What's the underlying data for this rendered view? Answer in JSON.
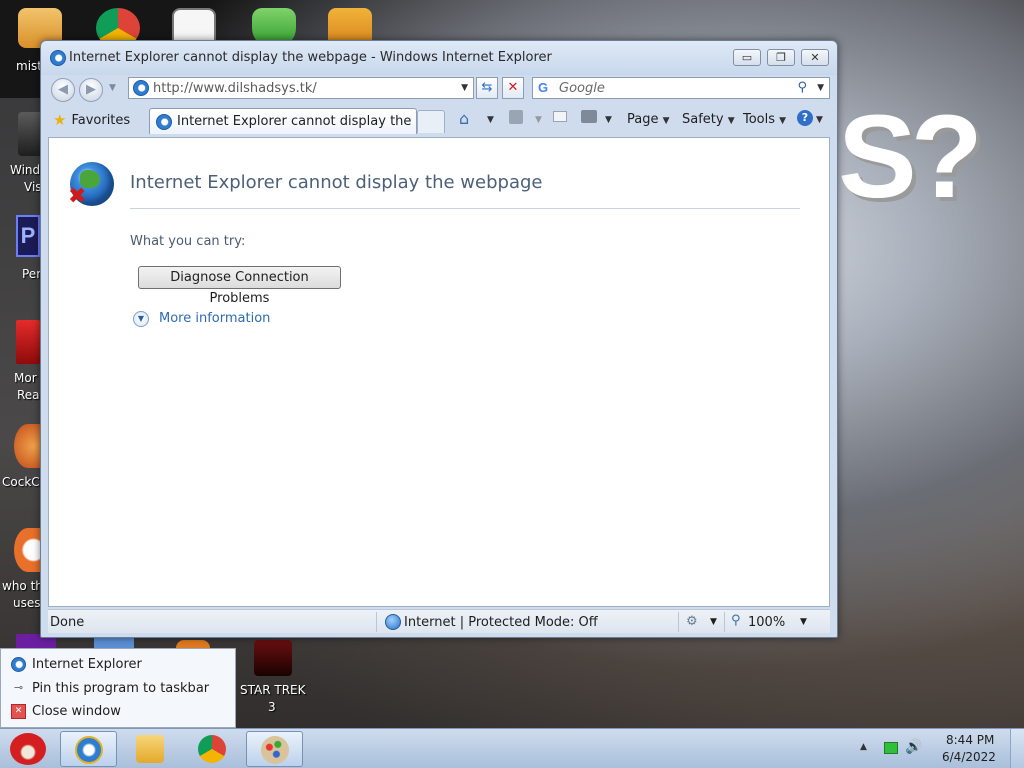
{
  "desktop": {
    "labels": {
      "mist": "mist",
      "windows_1": "Windo",
      "windows_2": "Vis",
      "per": "Per",
      "more_1": "Mor",
      "more_2": "Rea",
      "cockc": "CockC",
      "who_1": "who th",
      "who_2": "uses",
      "star_trek_1": "STAR TREK",
      "star_trek_2": "3"
    },
    "wallpaper_text": "S?"
  },
  "window": {
    "title": "Internet Explorer cannot display the webpage - Windows Internet Explorer",
    "caption": {
      "minimize": "▭",
      "maximize": "❐",
      "close": "✕"
    }
  },
  "navbar": {
    "address": "http://www.dilshadsys.tk/",
    "search_placeholder": "Google"
  },
  "commandbar": {
    "favorites_label": "Favorites",
    "tab_title": "Internet Explorer cannot display the we...",
    "page_label": "Page",
    "safety_label": "Safety",
    "tools_label": "Tools",
    "caret": "▼"
  },
  "page": {
    "heading": "Internet Explorer cannot display the webpage",
    "try_label": "What you can try:",
    "diagnose_button": "Diagnose Connection Problems",
    "more_info": "More information"
  },
  "statusbar": {
    "status": "Done",
    "zone": "Internet | Protected Mode: Off",
    "zoom": "100%"
  },
  "jumplist": {
    "items": [
      {
        "label": "Internet Explorer",
        "icon": "ie-icon"
      },
      {
        "label": "Pin this program to taskbar",
        "icon": "pin-icon"
      },
      {
        "label": "Close window",
        "icon": "close-window-icon"
      }
    ]
  },
  "taskbar": {
    "time": "8:44 PM",
    "date": "6/4/2022",
    "tray_arrow": "▲",
    "volume_icon": "🔊"
  },
  "colors": {
    "link": "#2e6bb0",
    "heading": "#4c607a",
    "close_x": "#d11a1a"
  }
}
